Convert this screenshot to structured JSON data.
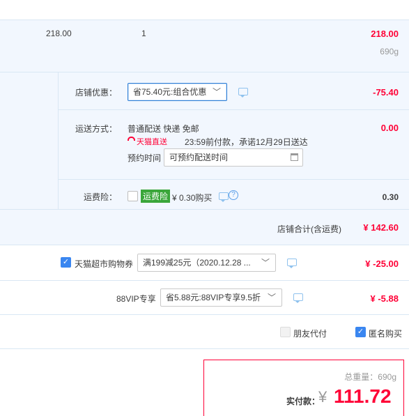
{
  "item": {
    "unit_price": "218.00",
    "quantity": "1",
    "subtotal": "218.00",
    "weight": "690g"
  },
  "shop_discount": {
    "label": "店铺优惠：",
    "selected": "省75.40元:组合优惠",
    "amount": "-75.40"
  },
  "shipping": {
    "label": "运送方式：",
    "method": "普通配送 快递 免邮",
    "badge": "天猫直送",
    "promise": "23:59前付款，承诺12月29日送达",
    "reserve_label": "预约时间",
    "reserve_placeholder": "可预约配送时间",
    "amount": "0.00"
  },
  "insurance": {
    "label": "运费险：",
    "tag": "运费险",
    "price": "¥ 0.30购买",
    "amount": "0.30"
  },
  "shop_total": {
    "label": "店铺合计(含运费)",
    "value": "¥ 142.60"
  },
  "coupon": {
    "label": "天猫超市购物券",
    "selected": "满199减25元（2020.12.28 ...",
    "amount": "¥ -25.00"
  },
  "vip": {
    "label": "88VIP专享",
    "selected": "省5.88元:88VIP专享9.5折",
    "amount": "¥ -5.88"
  },
  "options": {
    "friend_pay": "朋友代付",
    "anonymous": "匿名购买"
  },
  "summary": {
    "weight": "总重量：690g",
    "pay_label": "实付款：",
    "currency": "¥",
    "total": "111.72"
  },
  "colors": {
    "accent_red": "#ff0036",
    "panel_blue": "#f2f7fe",
    "border_blue": "#d9e7f4",
    "checkbox_blue": "#3a86f0"
  }
}
